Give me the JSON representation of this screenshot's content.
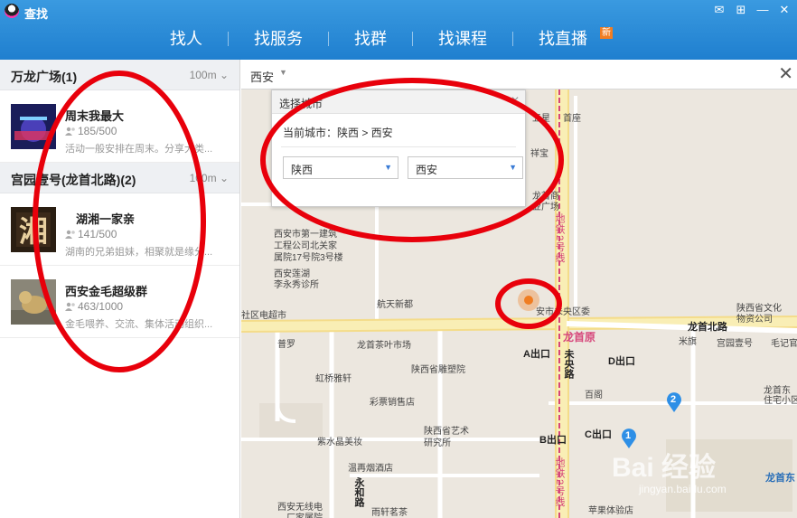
{
  "window": {
    "title": "查找"
  },
  "nav": {
    "tabs": [
      "找人",
      "找服务",
      "找群",
      "找课程",
      "找直播"
    ],
    "new_badge": "新"
  },
  "left_panel": {
    "groups": [
      {
        "name": "万龙广场(1)",
        "distance": "100m",
        "items": [
          {
            "name": "周末我最大",
            "count": "185/500",
            "desc": "活动一般安排在周末。分享大类..."
          }
        ]
      },
      {
        "name": "宫园壹号(龙首北路)(2)",
        "distance": "100m",
        "items": [
          {
            "name": "湖湘一家亲",
            "count": "141/500",
            "desc": "湖南的兄弟姐妹，相聚就是缘分..."
          },
          {
            "name": "西安金毛超级群",
            "count": "463/1000",
            "desc": "金毛喂养、交流、集体活动组织..."
          }
        ]
      }
    ]
  },
  "map": {
    "city": "西安",
    "popup": {
      "title": "选择城市",
      "current": "当前城市：陕西 > 西安",
      "province": "陕西",
      "city": "西安"
    },
    "labels": {
      "poi_1": "西安市第一建筑",
      "poi_2": "工程公司北关家",
      "poi_3": "属院17号院3号楼",
      "poi_4": "西安莲湖",
      "poi_5": "李永秀诊所",
      "poi_6": "航天新都",
      "poi_7": "社区电超市",
      "poi_8": "普罗",
      "poi_9": "龙首茶叶市场",
      "poi_10": "陕西省雕塑院",
      "poi_11": "虹桥雅轩",
      "poi_12": "彩票销售店",
      "poi_13": "紫水晶美妆",
      "poi_14": "陕西省艺术",
      "poi_15": "研究所",
      "poi_16": "温再烟酒店",
      "poi_17": "西安无线电",
      "poi_18": "厂家属院",
      "poi_19": "雨轩茗茶",
      "poi_20": "苹果体验店",
      "poi_21": "百阁",
      "poi_22": "米旗",
      "poi_23": "宫园壹号",
      "poi_24": "毛记官",
      "poi_25": "陕西省文化",
      "poi_26": "物资公司",
      "poi_27": "龙首东",
      "poi_28": "住宅小区",
      "poi_29": "龙首原",
      "poi_30": "首座",
      "poi_31": "祥宝",
      "poi_32": "五星",
      "poi_33": "龙首商",
      "poi_34": "业广场",
      "poi_35": "安市未央区委",
      "road_1": "龙首北路",
      "road_2": "未央路",
      "road_3": "永和路",
      "road_4": "龙首东",
      "metro_1": "地铁2号线",
      "metro_2": "地铁2号线",
      "exit_a": "A出口",
      "exit_b": "B出口",
      "exit_c": "C出口",
      "exit_d": "D出口",
      "marker_1": "1",
      "marker_2": "2",
      "watermark": "Bai 经验",
      "watermark_url": "jingyan.baidu.com"
    }
  },
  "colors": {
    "header": "#2a8cd8",
    "annotation": "#e8000b",
    "metro": "#d6457a",
    "road_major": "#f7e9a0",
    "map_bg": "#ece7df",
    "marker_blue": "#2e8fe6"
  }
}
